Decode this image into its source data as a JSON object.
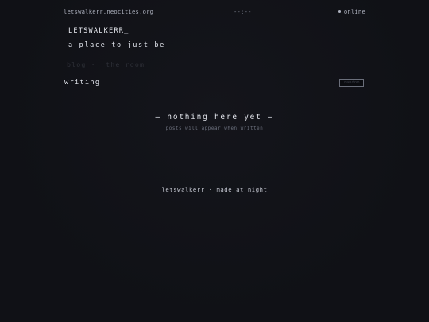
{
  "topbar": {
    "url": "letswalkerr.neocities.org",
    "clock": "--:--",
    "status": "online"
  },
  "header": {
    "brand": "LETSWALKERR_",
    "tagline": "a place to just be"
  },
  "nav": {
    "items": [
      "blog",
      "the room"
    ],
    "separator": "·"
  },
  "section": {
    "title": "writing",
    "button_label": "random"
  },
  "empty_state": {
    "title": "— nothing here yet —",
    "subtitle": "posts will appear when written"
  },
  "footer": {
    "text": "letswalkerr · made at night"
  },
  "colors": {
    "background": "#101116",
    "text": "#c9ccd6",
    "muted": "#6f7380"
  }
}
